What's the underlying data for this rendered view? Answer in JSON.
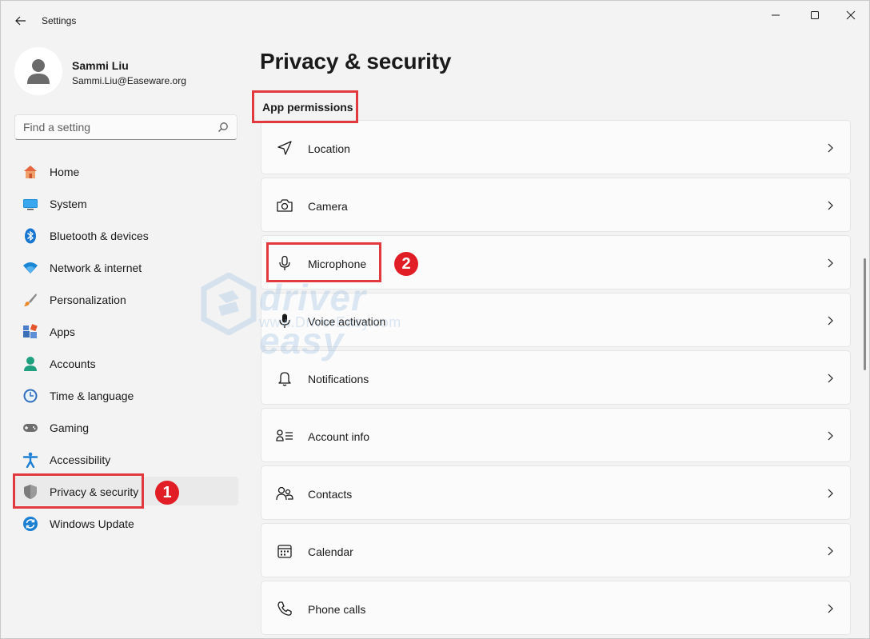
{
  "window": {
    "title": "Settings"
  },
  "profile": {
    "name": "Sammi Liu",
    "email": "Sammi.Liu@Easeware.org"
  },
  "search": {
    "placeholder": "Find a setting"
  },
  "nav": {
    "items": [
      {
        "label": "Home",
        "icon": "home-icon"
      },
      {
        "label": "System",
        "icon": "system-icon"
      },
      {
        "label": "Bluetooth & devices",
        "icon": "bluetooth-icon"
      },
      {
        "label": "Network & internet",
        "icon": "wifi-icon"
      },
      {
        "label": "Personalization",
        "icon": "brush-icon"
      },
      {
        "label": "Apps",
        "icon": "apps-icon"
      },
      {
        "label": "Accounts",
        "icon": "accounts-icon"
      },
      {
        "label": "Time & language",
        "icon": "time-language-icon"
      },
      {
        "label": "Gaming",
        "icon": "gamepad-icon"
      },
      {
        "label": "Accessibility",
        "icon": "accessibility-icon"
      },
      {
        "label": "Privacy & security",
        "icon": "shield-icon",
        "selected": true
      },
      {
        "label": "Windows Update",
        "icon": "update-icon"
      }
    ]
  },
  "main": {
    "title": "Privacy & security",
    "section": "App permissions",
    "rows": [
      {
        "label": "Location",
        "icon": "location-icon"
      },
      {
        "label": "Camera",
        "icon": "camera-icon"
      },
      {
        "label": "Microphone",
        "icon": "microphone-icon"
      },
      {
        "label": "Voice activation",
        "icon": "voice-activation-icon"
      },
      {
        "label": "Notifications",
        "icon": "bell-icon"
      },
      {
        "label": "Account info",
        "icon": "account-info-icon"
      },
      {
        "label": "Contacts",
        "icon": "contacts-icon"
      },
      {
        "label": "Calendar",
        "icon": "calendar-icon"
      },
      {
        "label": "Phone calls",
        "icon": "phone-icon"
      }
    ]
  },
  "annotations": {
    "step1": "1",
    "step2": "2",
    "highlight_color": "#e2393f",
    "badge_color": "#e11d26"
  },
  "watermark": {
    "brand": "driver easy",
    "url": "www.DriverEasy.com"
  },
  "colors": {
    "accent": "#0067c0",
    "window_bg": "#f3f3f3",
    "card_bg": "#fbfbfb"
  }
}
